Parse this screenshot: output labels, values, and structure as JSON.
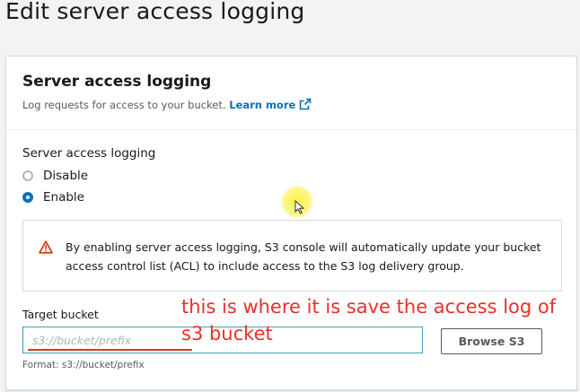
{
  "page": {
    "title": "Edit server access logging"
  },
  "panel": {
    "title": "Server access logging",
    "description": "Log requests for access to your bucket.",
    "learn_more": "Learn more"
  },
  "logging": {
    "label": "Server access logging",
    "options": [
      {
        "label": "Disable",
        "checked": false
      },
      {
        "label": "Enable",
        "checked": true
      }
    ]
  },
  "alert": {
    "icon": "warning-icon",
    "text": "By enabling server access logging, S3 console will automatically update your bucket access control list (ACL) to include access to the S3 log delivery group."
  },
  "target": {
    "label": "Target bucket",
    "placeholder": "s3://bucket/prefix",
    "value": "",
    "browse_label": "Browse S3",
    "format_hint": "Format: s3://bucket/prefix"
  },
  "annotation": {
    "text": "this is where it is save the access log of s3 bucket",
    "color": "#e8302a"
  },
  "colors": {
    "link": "#0073bb",
    "warning": "#d13212",
    "radio_selected": "#0073bb"
  }
}
